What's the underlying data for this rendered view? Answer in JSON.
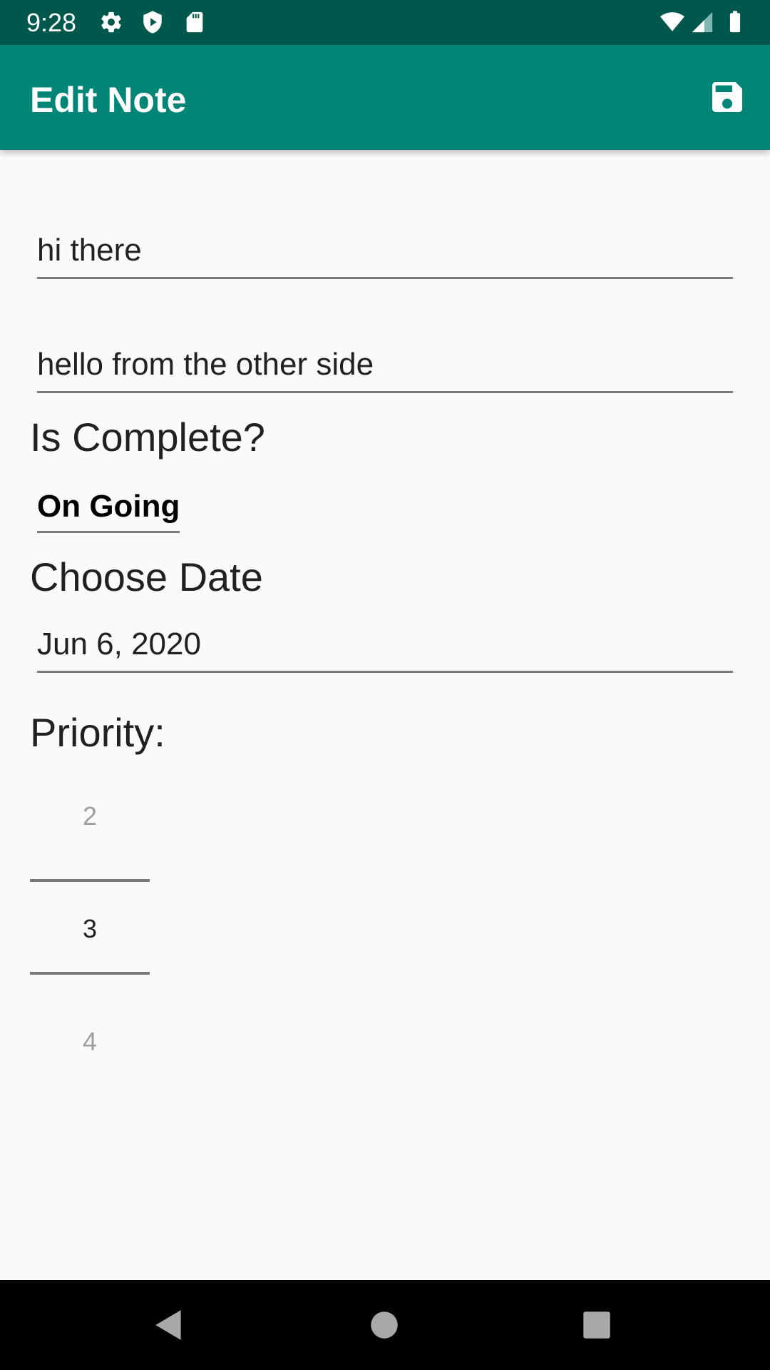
{
  "status_bar": {
    "time": "9:28",
    "icons_left": [
      "gear-icon",
      "shield-icon",
      "sd-card-icon"
    ],
    "icons_right": [
      "wifi-icon",
      "signal-icon",
      "battery-icon"
    ],
    "background": "#00574b"
  },
  "app_bar": {
    "title": "Edit Note",
    "action_icon": "save-icon",
    "background": "#008577"
  },
  "form": {
    "title_value": "hi there",
    "body_value": "hello from the other side",
    "complete_label": "Is Complete?",
    "complete_selected": "On Going",
    "date_label": "Choose Date",
    "date_value": "Jun 6, 2020",
    "priority_label": "Priority:",
    "priority_picker": {
      "previous": "2",
      "current": "3",
      "next": "4"
    }
  },
  "nav_bar": {
    "icons": [
      "back-icon",
      "home-icon",
      "recents-icon"
    ]
  }
}
